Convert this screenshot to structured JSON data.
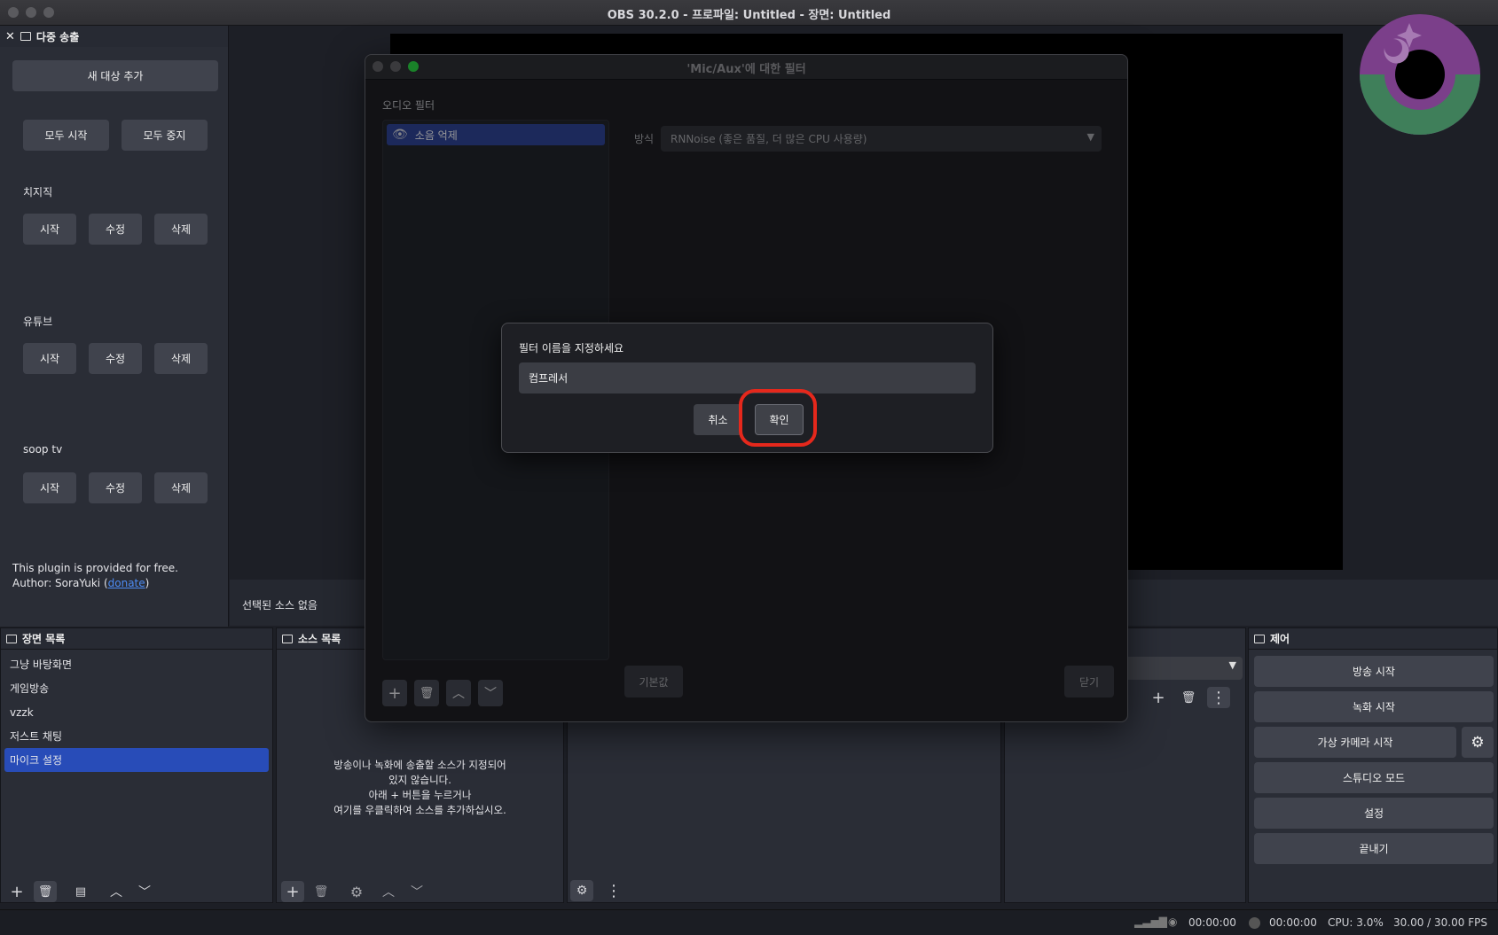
{
  "window": {
    "title": "OBS 30.2.0 - 프로파일: Untitled - 장면: Untitled"
  },
  "multistream": {
    "title": "다중 송출",
    "add_target": "새 대상 추가",
    "start_all": "모두 시작",
    "stop_all": "모두 중지",
    "targets": [
      {
        "name": "치지직",
        "start": "시작",
        "edit": "수정",
        "delete": "삭제"
      },
      {
        "name": "유튜브",
        "start": "시작",
        "edit": "수정",
        "delete": "삭제"
      },
      {
        "name": "soop tv",
        "start": "시작",
        "edit": "수정",
        "delete": "삭제"
      }
    ],
    "plugin_note": "This plugin is provided for free.",
    "author_prefix": "Author: SoraYuki (",
    "author_link": "donate",
    "author_suffix": ")"
  },
  "preview": {
    "no_source": "선택된 소스 없음"
  },
  "scenes": {
    "title": "장면 목록",
    "items": [
      "그냥 바탕화면",
      "게임방송",
      "vzzk",
      "저스트 채팅",
      "마이크 설정"
    ],
    "selected_index": 4
  },
  "sources": {
    "title": "소스 목록",
    "empty_lines": [
      "방송이나 녹화에 송출할 소스가 지정되어",
      "있지 않습니다.",
      "아래 + 버튼을 누르거나",
      "여기를 우클릭하여 소스를 추가하십시오."
    ]
  },
  "controls": {
    "title": "제어",
    "start_stream": "방송 시작",
    "start_record": "녹화 시작",
    "virtual_cam": "가상 카메라 시작",
    "studio_mode": "스튜디오 모드",
    "settings": "설정",
    "exit": "끝내기"
  },
  "filter_window": {
    "title": "'Mic/Aux'에 대한 필터",
    "section": "오디오 필터",
    "filters": [
      "소음 억제"
    ],
    "method_label": "방식",
    "method_value": "RNNoise (좋은 품질, 더 많은 CPU 사용량)",
    "defaults": "기본값",
    "close": "닫기"
  },
  "name_dialog": {
    "prompt": "필터 이름을 지정하세요",
    "value": "컴프레서",
    "cancel": "취소",
    "ok": "확인"
  },
  "status": {
    "stream_time": "00:00:00",
    "record_time": "00:00:00",
    "cpu": "CPU: 3.0%",
    "fps": "30.00 / 30.00 FPS"
  },
  "colors": {
    "accent": "#284cb8",
    "highlight": "#e5281c",
    "panel": "#2a2d36"
  }
}
